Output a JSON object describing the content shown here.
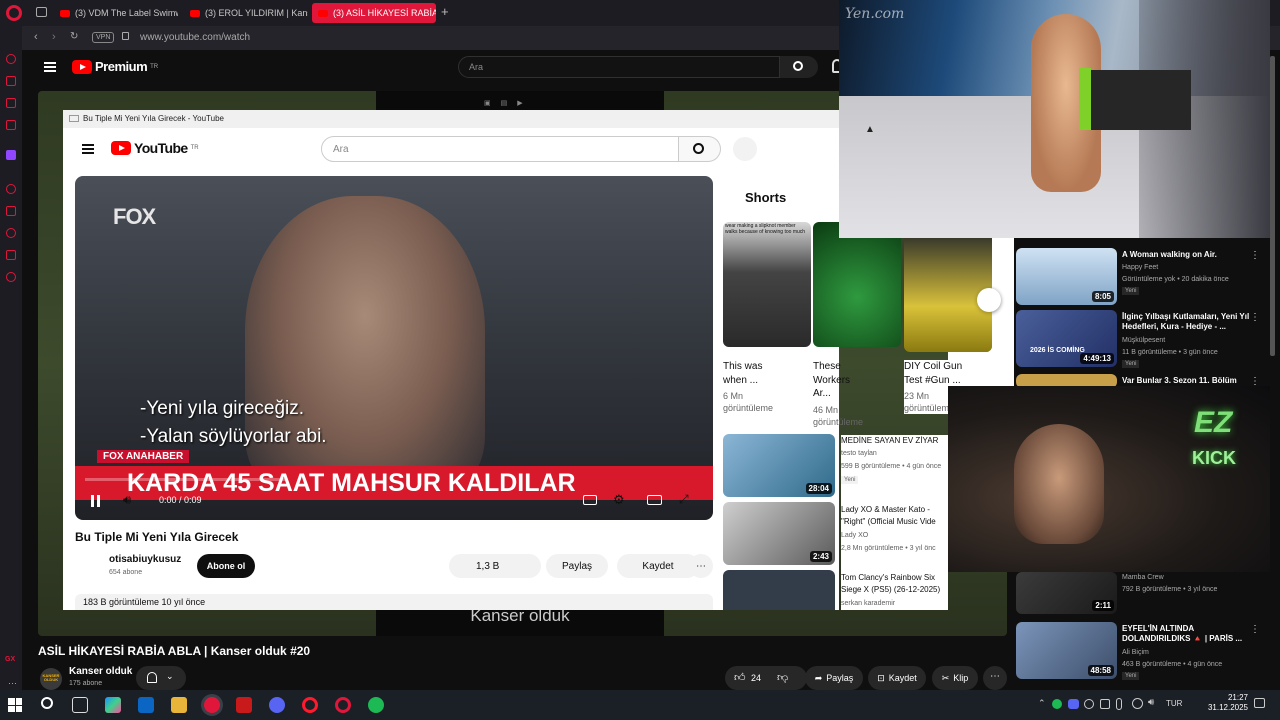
{
  "browser": {
    "tabs": [
      {
        "label": "(3) VDM The Label Swimw"
      },
      {
        "label": "(3) EROL YILDIRIM | Kanse"
      },
      {
        "label": "(3) ASİL HİKAYESİ RABİA A"
      }
    ],
    "vpn_label": "VPN",
    "url": "www.youtube.com/watch"
  },
  "youtube": {
    "brand": "Premium",
    "brand_sup": "TR",
    "search_placeholder": "Ara",
    "player_subtitle": "Kanser olduk",
    "video_title": "ASİL HİKAYESİ RABİA ABLA | Kanser olduk #20",
    "channel_name": "Kanser olduk",
    "channel_subs": "175 abone",
    "channel_avatar_text": "KANSER OLDUK",
    "likes": "24",
    "share_label": "Paylaş",
    "save_label": "Kaydet",
    "clip_label": "Klip"
  },
  "popup": {
    "window_title": "Bu Tiple Mi Yeni Yıla Girecek - YouTube",
    "brand": "YouTube",
    "brand_sup": "TR",
    "search_placeholder": "Ara",
    "video": {
      "overlay_logo": "FOX",
      "caption_line1": "-Yeni yıla gireceğiz.",
      "caption_line2": "-Yalan söylüyorlar abi.",
      "ticker_label": "FOX ANAHABER",
      "ticker_text": "KARDA 45 SAAT MAHSUR KALDILAR",
      "time": "0:00 / 0:09",
      "progress": 0
    },
    "title": "Bu Tiple Mi Yeni Yıla Girecek",
    "channel_name": "otisabiuykusuz",
    "channel_subs": "654 abone",
    "subscribe_label": "Abone ol",
    "likes": "1,3 B",
    "share_label": "Paylaş",
    "save_label": "Kaydet",
    "views_line": "183 B görüntüleme  10 yıl önce",
    "shorts_heading": "Shorts",
    "shorts": [
      {
        "title1": "This was",
        "title2": "when ...",
        "views1": "6 Mn",
        "views2": "görüntüleme",
        "thumb_text": "wear making a slipknot member walks because of knowing too much",
        "color": "#6b6b6b"
      },
      {
        "title1": "These",
        "title2": "Workers Ar...",
        "views1": "46 Mn",
        "views2": "görüntüleme",
        "color": "#1f6b2a"
      },
      {
        "title1": "DIY Coil Gun",
        "title2": "Test #Gun ...",
        "views1": "23 Mn",
        "views2": "görüntüleme",
        "color": "#c9b92a"
      }
    ],
    "recs": [
      {
        "title": "MEDİNE SAYAN EV ZİYAR",
        "channel": "testo taylan",
        "meta": "599 B görüntüleme • 4 gün önce",
        "badge": "Yeni",
        "duration": "28:04",
        "color": "#4a7da0"
      },
      {
        "title": "Lady XO & Master Kato - \"Right\" (Official Music Vide",
        "channel": "Lady XO",
        "meta": "2,8 Mn görüntüleme • 3 yıl önc",
        "badge": "",
        "duration": "2:43",
        "color": "#8a8a8a"
      },
      {
        "title": "Tom Clancy's Rainbow Six Siege X (PS5) (26-12-2025)",
        "channel": "serkan karademir",
        "meta": "",
        "badge": "",
        "duration": "",
        "color": "#333d4a"
      }
    ]
  },
  "right_recs": [
    {
      "title": "A Woman walking on Air.",
      "channel": "Happy Feet",
      "meta": "Görüntüleme yok • 20 dakika önce",
      "badge": "Yeni",
      "duration": "8:05",
      "color": "#8fb3d6"
    },
    {
      "title": "İlginç Yılbaşı Kutlamaları, Yeni Yıl Hedefleri, Kura - Hediye - ...",
      "channel": "Müşkülpesent",
      "meta": "11 B görüntüleme • 3 gün önce",
      "badge": "Yeni",
      "duration": "4:49:13",
      "thumb_text": "2026 İS COMİNG",
      "color": "#3a4d7a"
    },
    {
      "title": "Var Bunlar 3. Sezon 11. Bölüm",
      "channel": "",
      "meta": "",
      "badge": "",
      "duration": "",
      "color": "#c9a04a"
    },
    {
      "title": "",
      "channel": "Mamba Crew",
      "meta": "792 B görüntüleme • 3 yıl önce",
      "badge": "",
      "duration": "2:11",
      "color": "#2d2d2d"
    },
    {
      "title": "EYFEL'İN ALTINDA DOLANDIRILDIKS 🔺 | PARİS ...",
      "channel": "Ali Biçim",
      "meta": "463 B görüntüleme • 4 gün önce",
      "badge": "Yeni",
      "duration": "48:58",
      "color": "#5a6e8a"
    }
  ],
  "overlay": {
    "watermark": "Yen.com",
    "sign_text1": "EZ",
    "sign_text2": "KICK"
  },
  "taskbar": {
    "time": "21:27",
    "date": "31.12.2025",
    "lang": "TUR"
  }
}
